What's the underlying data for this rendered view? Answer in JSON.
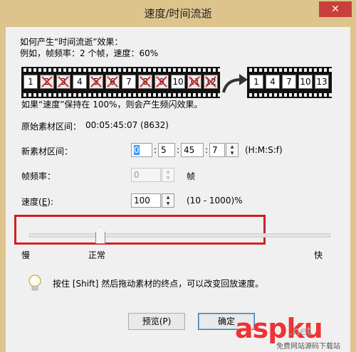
{
  "window": {
    "title": "速度/时间流逝",
    "close_glyph": "✕"
  },
  "intro": {
    "line1": "如何产生“时间流逝”效果：",
    "line2": "例如，帧频率：2 个帧，速度：60%"
  },
  "film_before": [
    {
      "n": "1",
      "crossed": false
    },
    {
      "n": "2",
      "crossed": true
    },
    {
      "n": "3",
      "crossed": true
    },
    {
      "n": "4",
      "crossed": false
    },
    {
      "n": "5",
      "crossed": true
    },
    {
      "n": "6",
      "crossed": true
    },
    {
      "n": "7",
      "crossed": false
    },
    {
      "n": "8",
      "crossed": true
    },
    {
      "n": "9",
      "crossed": true
    },
    {
      "n": "10",
      "crossed": false
    },
    {
      "n": "11",
      "crossed": true
    },
    {
      "n": "12",
      "crossed": true
    }
  ],
  "film_after": [
    "1",
    "4",
    "7",
    "10",
    "13"
  ],
  "film_note": "如果“速度”保持在 100%，则会产生频闪效果。",
  "original_range": {
    "label": "原始素材区间：",
    "value": "00:05:45:07 (8632)"
  },
  "new_range": {
    "label": "新素材区间：",
    "h": "0",
    "m": "5",
    "s": "45",
    "f": "7",
    "sep": ":",
    "format": "(H:M:S:f)"
  },
  "frame_rate": {
    "label": "帧频率：",
    "value": "0",
    "unit": "帧"
  },
  "speed": {
    "label_pre": "速度(",
    "label_key": "E",
    "label_post": "):",
    "value": "100",
    "range": "(10 - 1000)%"
  },
  "slider": {
    "left": "慢",
    "mid": "正常",
    "right": "快",
    "value_percent": 100,
    "min": 10,
    "max": 1000
  },
  "tip": "按住 [Shift] 然后拖动素材的终点，可以改变回放速度。",
  "buttons": {
    "preview": "预览(P)",
    "ok": "确定"
  },
  "watermark": {
    "brand": "aspku",
    "tld": ".net",
    "sub": "免费网站源码下载站"
  },
  "colors": {
    "title_bar": "#dcc48c",
    "close": "#c7413a",
    "highlight": "#d0202a",
    "watermark": "#e33333"
  }
}
